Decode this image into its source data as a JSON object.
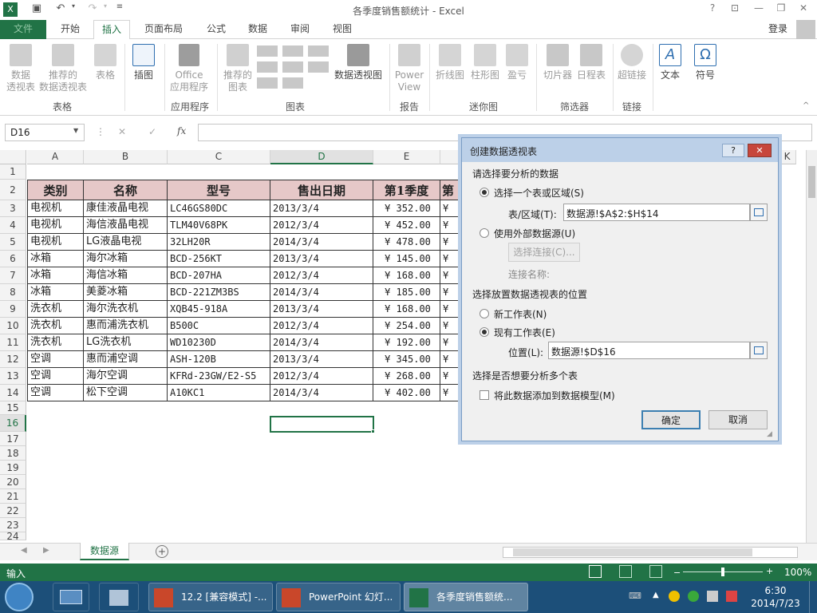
{
  "app": {
    "title": "各季度销售额统计 - Excel",
    "login": "登录"
  },
  "ribbon_tabs": [
    "文件",
    "开始",
    "插入",
    "页面布局",
    "公式",
    "数据",
    "审阅",
    "视图"
  ],
  "ribbon": {
    "pivot": "数据\n透视表",
    "rec_pivot": "推荐的\n数据透视表",
    "table": "表格",
    "illustrations": "插图",
    "office_apps": "Office\n应用程序",
    "rec_charts": "推荐的\n图表",
    "pivot_chart": "数据透视图",
    "power_view": "Power\nView",
    "line": "折线图",
    "column": "柱形图",
    "winloss": "盈亏",
    "slicer": "切片器",
    "timeline": "日程表",
    "hyperlink": "超链接",
    "text": "文本",
    "symbol": "符号",
    "groups": {
      "tables": "表格",
      "apps": "应用程序",
      "charts": "图表",
      "reports": "报告",
      "sparklines": "迷你图",
      "filters": "筛选器",
      "links": "链接"
    }
  },
  "namebox": "D16",
  "columns": [
    "A",
    "B",
    "C",
    "D",
    "E",
    "K"
  ],
  "header_row": [
    "类别",
    "名称",
    "型号",
    "售出日期",
    "第1季度",
    "第"
  ],
  "rows": [
    [
      "电视机",
      "康佳液晶电视",
      "LC46GS80DC",
      "2013/3/4",
      "¥ 352.00",
      "¥"
    ],
    [
      "电视机",
      "海信液晶电视",
      "TLM40V68PK",
      "2012/3/4",
      "¥ 452.00",
      "¥"
    ],
    [
      "电视机",
      "LG液晶电视",
      "32LH20R",
      "2014/3/4",
      "¥ 478.00",
      "¥"
    ],
    [
      "冰箱",
      "海尔冰箱",
      "BCD-256KT",
      "2013/3/4",
      "¥ 145.00",
      "¥"
    ],
    [
      "冰箱",
      "海信冰箱",
      "BCD-207HA",
      "2012/3/4",
      "¥ 168.00",
      "¥"
    ],
    [
      "冰箱",
      "美菱冰箱",
      "BCD-221ZM3BS",
      "2014/3/4",
      "¥ 185.00",
      "¥"
    ],
    [
      "洗衣机",
      "海尔洗衣机",
      "XQB45-918A",
      "2013/3/4",
      "¥ 168.00",
      "¥"
    ],
    [
      "洗衣机",
      "惠而浦洗衣机",
      "B500C",
      "2012/3/4",
      "¥ 254.00",
      "¥"
    ],
    [
      "洗衣机",
      "LG洗衣机",
      "WD10230D",
      "2014/3/4",
      "¥ 192.00",
      "¥"
    ],
    [
      "空调",
      "惠而浦空调",
      "ASH-120B",
      "2013/3/4",
      "¥ 345.00",
      "¥"
    ],
    [
      "空调",
      "海尔空调",
      "KFRd-23GW/E2-S5",
      "2012/3/4",
      "¥ 268.00",
      "¥"
    ],
    [
      "空调",
      "松下空调",
      "A10KC1",
      "2014/3/4",
      "¥ 402.00",
      "¥"
    ]
  ],
  "row_numbers": [
    "1",
    "2",
    "3",
    "4",
    "5",
    "6",
    "7",
    "8",
    "9",
    "10",
    "11",
    "12",
    "13",
    "14",
    "15",
    "16",
    "17",
    "18",
    "19",
    "20",
    "21",
    "22",
    "23",
    "24"
  ],
  "dialog": {
    "title": "创建数据透视表",
    "section1": "请选择要分析的数据",
    "opt_select_range": "选择一个表或区域(S)",
    "range_label": "表/区域(T):",
    "range_value": "数据源!$A$2:$H$14",
    "opt_external": "使用外部数据源(U)",
    "choose_conn": "选择连接(C)...",
    "conn_name": "连接名称:",
    "section2": "选择放置数据透视表的位置",
    "opt_new_sheet": "新工作表(N)",
    "opt_existing": "现有工作表(E)",
    "location_label": "位置(L):",
    "location_value": "数据源!$D$16",
    "section3": "选择是否想要分析多个表",
    "add_model": "将此数据添加到数据模型(M)",
    "ok": "确定",
    "cancel": "取消"
  },
  "sheet_tab": "数据源",
  "status": {
    "mode": "输入",
    "zoom": "100%"
  },
  "taskbar": {
    "tasks": [
      "12.2 [兼容模式] -...",
      "PowerPoint 幻灯...",
      "各季度销售额统..."
    ],
    "time": "6:30",
    "date": "2014/7/23"
  },
  "colors": {
    "excel_green": "#217346",
    "header_fill": "#e6c8c8"
  }
}
